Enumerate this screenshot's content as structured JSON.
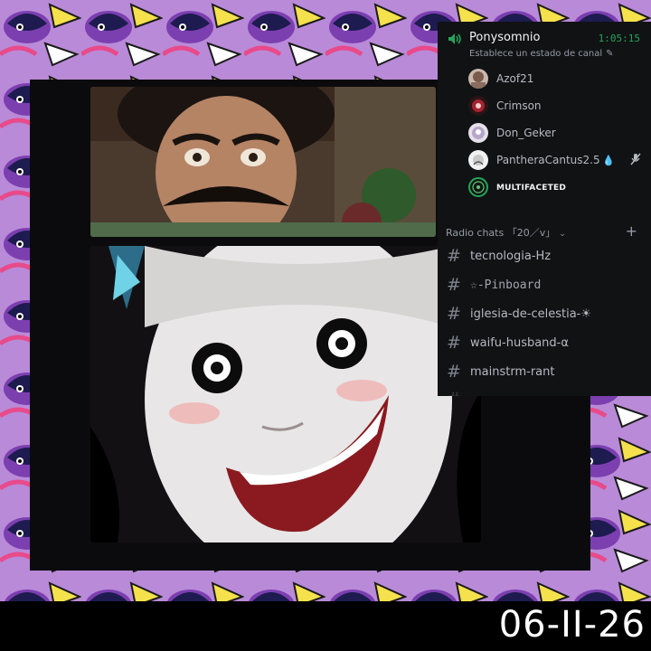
{
  "voice_channel": {
    "name": "Ponysomnio",
    "elapsed": "1:05:15",
    "status_prompt": "Establece un estado de canal"
  },
  "members": [
    {
      "name": "Azof21"
    },
    {
      "name": "Crimson"
    },
    {
      "name": "Don_Geker"
    },
    {
      "name": "PantheraCantus2.5"
    },
    {
      "name": "MULTIFACETED"
    }
  ],
  "category": {
    "label": "Radio chats 「20／v」"
  },
  "channels": [
    {
      "name": "tecnologia-Hz"
    },
    {
      "name": "☆-Pinboard"
    },
    {
      "name": "iglesia-de-celestia-☀"
    },
    {
      "name": "waifu-husband-α"
    },
    {
      "name": "mainstrm-rant"
    }
  ],
  "footer": {
    "date": "06-II-26"
  },
  "colors": {
    "background_pattern": "#b98ad8",
    "speaking_green": "#23a559",
    "sidebar_bg": "#111214"
  }
}
